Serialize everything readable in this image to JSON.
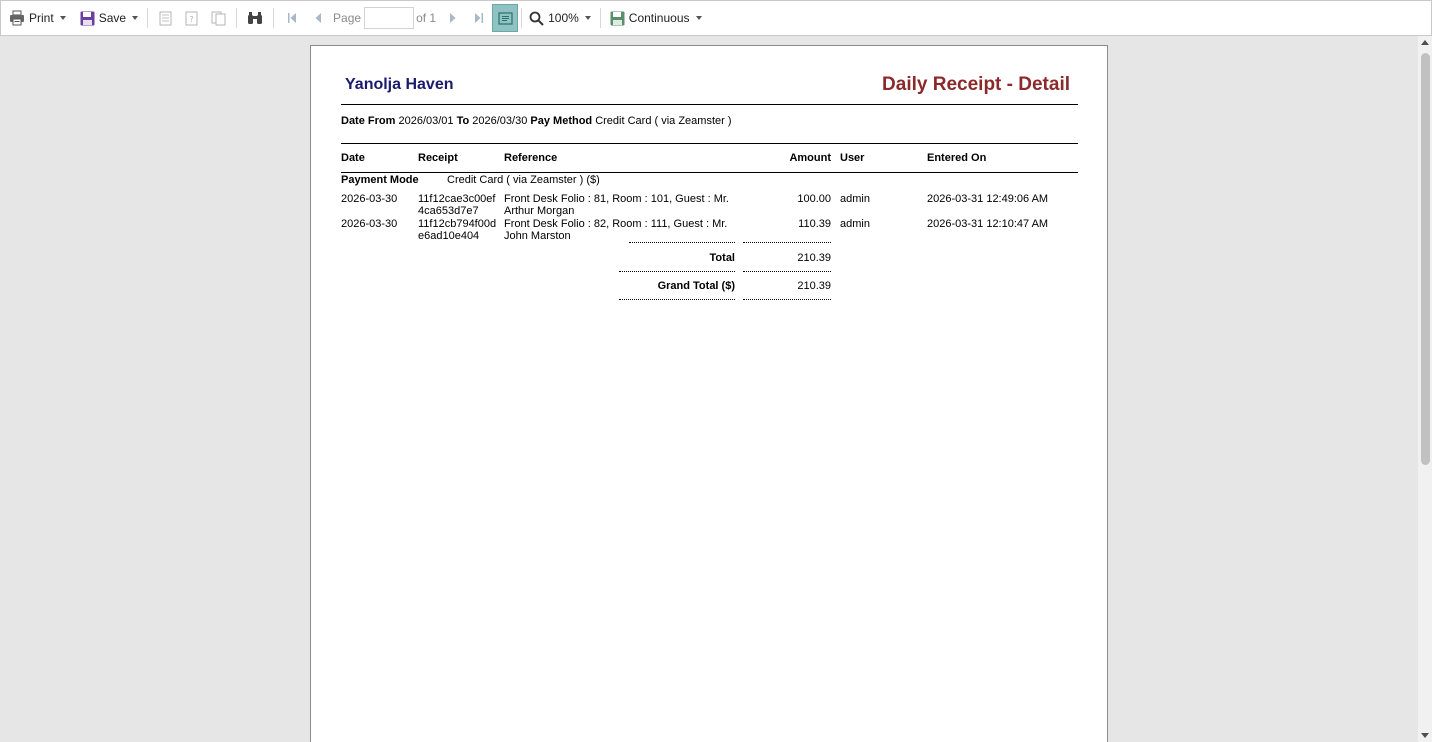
{
  "toolbar": {
    "print_label": "Print",
    "save_label": "Save",
    "page_label": "Page",
    "page_value": "",
    "of_label": "of 1",
    "zoom_label": "100%",
    "view_mode_label": "Continuous"
  },
  "report": {
    "company": "Yanolja Haven",
    "title": "Daily Receipt - Detail",
    "filter": {
      "date_from_label": "Date From",
      "date_from": "2026/03/01",
      "to_label": "To",
      "date_to": "2026/03/30",
      "pay_method_label": "Pay Method",
      "pay_method": "Credit Card ( via Zeamster )"
    },
    "columns": {
      "date": "Date",
      "receipt": "Receipt",
      "reference": "Reference",
      "amount": "Amount",
      "user": "User",
      "entered_on": "Entered On"
    },
    "payment_mode": {
      "label": "Payment Mode",
      "value": "Credit Card ( via Zeamster ) ($)"
    },
    "rows": [
      {
        "date": "2026-03-30",
        "receipt_1": "11f12cae3c00ef",
        "receipt_2": "4ca653d7e7",
        "reference_1": "Front Desk Folio : 81, Room : 101, Guest : Mr.",
        "reference_2": "Arthur Morgan",
        "amount": "100.00",
        "user": "admin",
        "entered_on": "2026-03-31 12:49:06 AM"
      },
      {
        "date": "2026-03-30",
        "receipt_1": "11f12cb794f00d",
        "receipt_2": "e6ad10e404",
        "reference_1": "Front Desk Folio : 82, Room : 111, Guest : Mr.",
        "reference_2": "John Marston",
        "amount": "110.39",
        "user": "admin",
        "entered_on": "2026-03-31 12:10:47 AM"
      }
    ],
    "total_label": "Total",
    "total_value": "210.39",
    "grand_total_label": "Grand Total ($)",
    "grand_total_value": "210.39"
  }
}
